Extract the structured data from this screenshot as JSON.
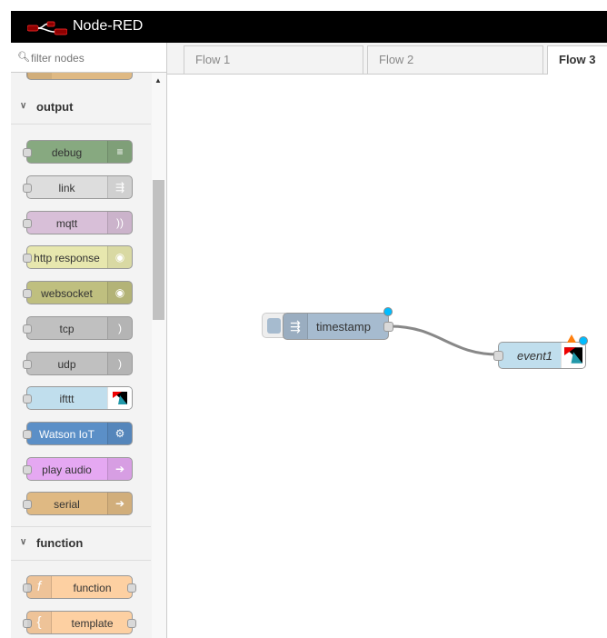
{
  "app": {
    "title": "Node-RED"
  },
  "palette": {
    "filter_placeholder": "filter nodes",
    "categories": [
      {
        "name": "output",
        "nodes": [
          {
            "label": "debug",
            "icon": "debug-icon",
            "color": "#87a980"
          },
          {
            "label": "link",
            "icon": "link-out-icon",
            "color": "#dddddd"
          },
          {
            "label": "mqtt",
            "icon": "bridge-icon",
            "color": "#d8bfd8"
          },
          {
            "label": "http response",
            "icon": "white-globe-icon",
            "color": "#e7e7ae"
          },
          {
            "label": "websocket",
            "icon": "white-globe-icon",
            "color": "#bfbf7f"
          },
          {
            "label": "tcp",
            "icon": "bridge-dash-icon",
            "color": "#c0c0c0"
          },
          {
            "label": "udp",
            "icon": "bridge-dash-icon",
            "color": "#c0c0c0"
          },
          {
            "label": "ifttt",
            "icon": "ifttt-icon",
            "color": "#c0deed"
          },
          {
            "label": "Watson IoT",
            "icon": "watson-iot-icon",
            "color": "#5b8fc7"
          },
          {
            "label": "play audio",
            "icon": "arrow-right-icon",
            "color": "#e5a8f2"
          },
          {
            "label": "serial",
            "icon": "arrow-right-icon",
            "color": "#dfb983"
          }
        ]
      },
      {
        "name": "function",
        "nodes": [
          {
            "label": "function",
            "icon": "function-icon",
            "color": "#fdd0a2"
          },
          {
            "label": "template",
            "icon": "template-icon",
            "color": "#fdd0a2"
          }
        ]
      }
    ]
  },
  "tabs": [
    {
      "label": "Flow 1"
    },
    {
      "label": "Flow 2"
    },
    {
      "label": "Flow 3",
      "active": true
    }
  ],
  "workspace": {
    "nodes": [
      {
        "label": "timestamp",
        "type": "inject",
        "color": "#a6bbcf"
      },
      {
        "label": "event1",
        "type": "ifttt",
        "color": "#c0deed"
      }
    ]
  }
}
